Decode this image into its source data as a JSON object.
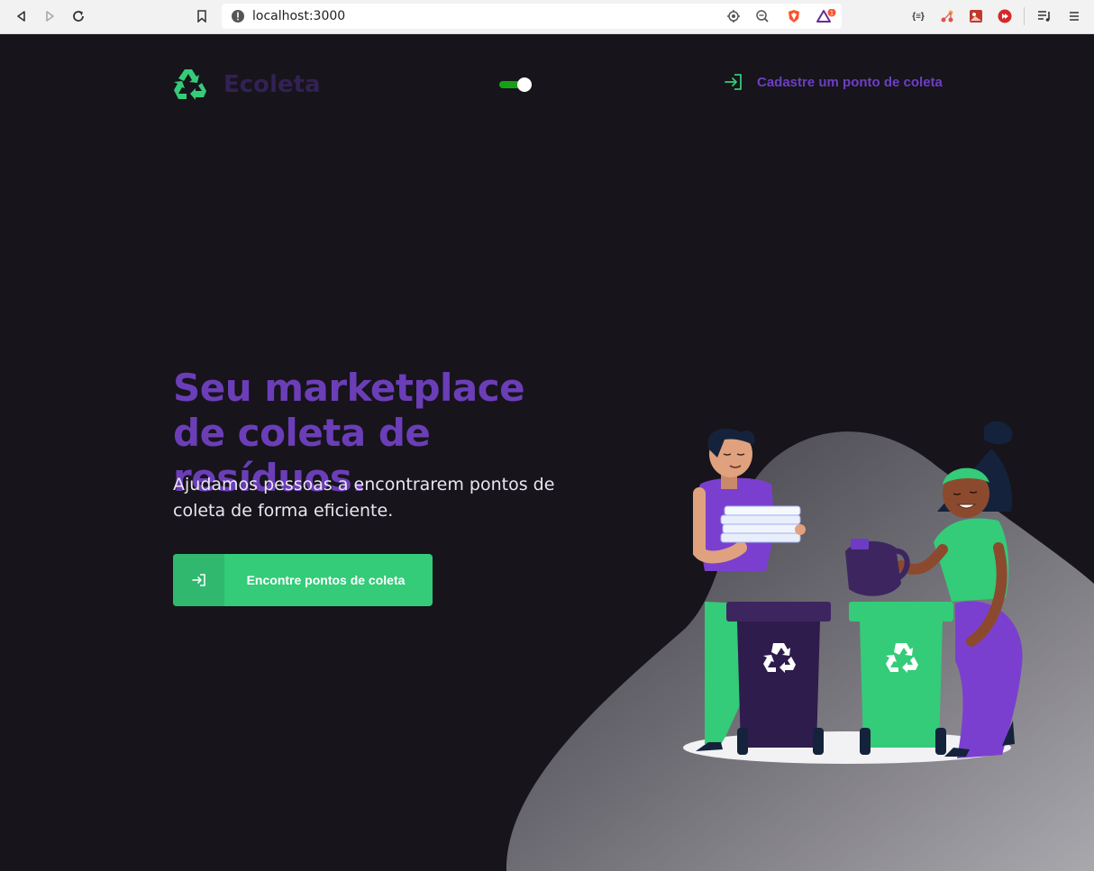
{
  "browser": {
    "url": "localhost:3000",
    "notification_badge": "1"
  },
  "header": {
    "logo_text": "Ecoleta",
    "theme_toggle_on": true,
    "register_link": "Cadastre um ponto de coleta"
  },
  "hero": {
    "title": "Seu marketplace de coleta de resíduos.",
    "subtitle": "Ajudamos pessoas a encontrarem pontos de coleta de forma eficiente.",
    "cta_label": "Encontre pontos de coleta"
  },
  "colors": {
    "background": "#17141b",
    "accent_green": "#34cb79",
    "accent_purple": "#6b3eb8",
    "logo_dark": "#322153"
  }
}
